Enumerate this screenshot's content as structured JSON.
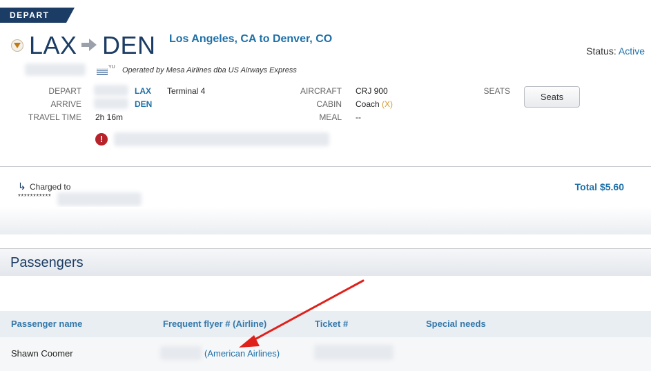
{
  "depart_tab": {
    "label": "DEPART",
    "color": "#1b3c64"
  },
  "route": {
    "origin": "LAX",
    "destination": "DEN",
    "description": "Los Angeles, CA to Denver, CO"
  },
  "status": {
    "label": "Status:",
    "value": "Active"
  },
  "flag_tag": "YU",
  "operated_by": "Operated by Mesa Airlines dba US Airways Express",
  "details": {
    "depart_label": "DEPART",
    "depart_code": "LAX",
    "terminal": "Terminal 4",
    "arrive_label": "ARRIVE",
    "arrive_code": "DEN",
    "travel_time_label": "TRAVEL TIME",
    "travel_time": "2h 16m",
    "aircraft_label": "AIRCRAFT",
    "aircraft": "CRJ 900",
    "cabin_label": "CABIN",
    "cabin": "Coach",
    "cabin_change": "(X)",
    "meal_label": "MEAL",
    "meal": "--",
    "seats_label": "SEATS",
    "seats_button": "Seats"
  },
  "alert_icon": "!",
  "payment": {
    "charged_icon": "↳",
    "charged_label": "Charged to",
    "card_mask": "***********",
    "total": "Total $5.60"
  },
  "passengers": {
    "title": "Passengers",
    "columns": [
      "Passenger name",
      "Frequent flyer # (Airline)",
      "Ticket #",
      "Special needs"
    ],
    "rows": [
      {
        "name": "Shawn Coomer",
        "airline": "(American Airlines)"
      }
    ]
  },
  "colors": {
    "brand_navy": "#1b3c64",
    "link_blue": "#1d70a8",
    "alert_red": "#b7232a",
    "annotation_red": "#e0201b"
  }
}
